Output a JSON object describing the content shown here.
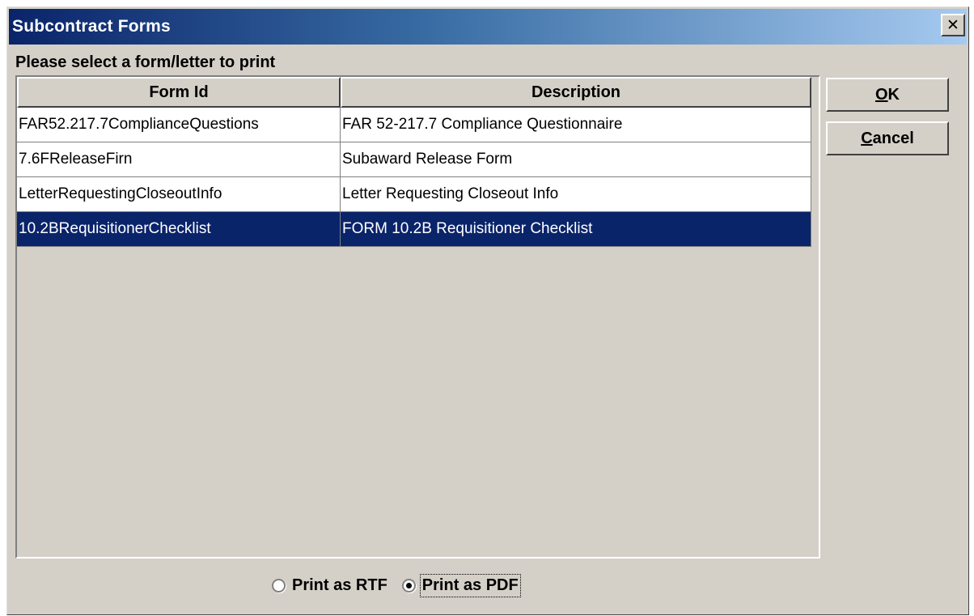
{
  "window": {
    "title": "Subcontract Forms",
    "close_glyph": "✕"
  },
  "prompt": "Please select a form/letter to print",
  "table": {
    "columns": [
      "Form Id",
      "Description"
    ],
    "rows": [
      {
        "form_id": "FAR52.217.7ComplianceQuestions",
        "description": "FAR 52-217.7 Compliance Questionnaire",
        "selected": false
      },
      {
        "form_id": "7.6FReleaseFirn",
        "description": "Subaward Release Form",
        "selected": false
      },
      {
        "form_id": "LetterRequestingCloseoutInfo",
        "description": "Letter Requesting Closeout Info",
        "selected": false
      },
      {
        "form_id": "10.2BRequisitionerChecklist",
        "description": "FORM 10.2B Requisitioner Checklist",
        "selected": true
      }
    ]
  },
  "buttons": {
    "ok": {
      "accel": "O",
      "rest": "K"
    },
    "cancel": {
      "accel": "C",
      "rest": "ancel"
    }
  },
  "print_options": [
    {
      "label": "Print as RTF",
      "checked": false
    },
    {
      "label": "Print as PDF",
      "checked": true
    }
  ],
  "colors": {
    "selection": "#0a246a",
    "dialog_face": "#d4d0c8",
    "titlebar_start": "#0a246a",
    "titlebar_end": "#a6caf0"
  }
}
